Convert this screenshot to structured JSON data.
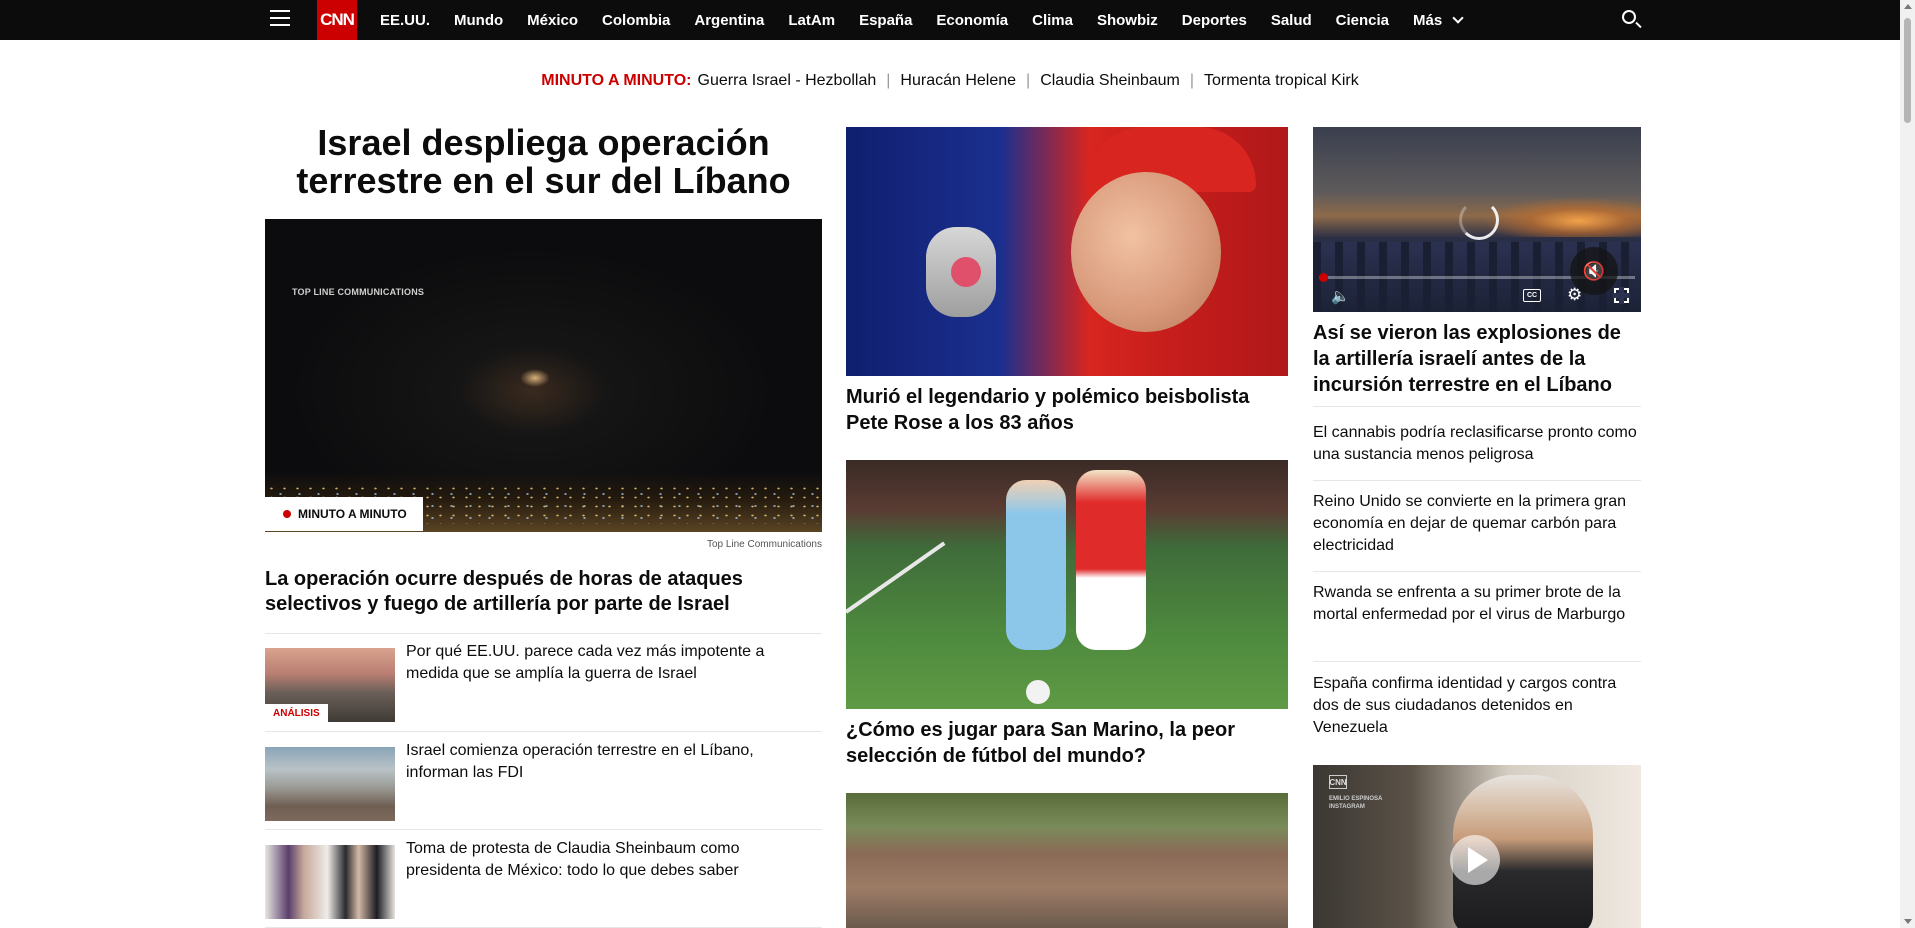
{
  "nav": {
    "logo": "CNN",
    "links": [
      "EE.UU.",
      "Mundo",
      "México",
      "Colombia",
      "Argentina",
      "LatAm",
      "España",
      "Economía",
      "Clima",
      "Showbiz",
      "Deportes",
      "Salud",
      "Ciencia"
    ],
    "more_label": "Más"
  },
  "ticker": {
    "label": "MINUTO A MINUTO:",
    "items": [
      "Guerra Israel - Hezbollah",
      "Huracán Helene",
      "Claudia Sheinbaum",
      "Tormenta tropical Kirk"
    ],
    "separator": "|"
  },
  "lead": {
    "headline": "Israel despliega operación terrestre en el sur del Líbano",
    "image_watermark": "TOP LINE COMMUNICATIONS",
    "live_tag": "MINUTO A MINUTO",
    "image_credit": "Top Line Communications",
    "subheadline": "La operación ocurre después de horas de ataques selectivos y fuego de artillería por parte de Israel",
    "related": [
      {
        "title": "Por qué EE.UU. parece cada vez más impotente a medida que se amplía la guerra de Israel",
        "badge": "ANÁLISIS"
      },
      {
        "title": "Israel comienza operación terrestre en el Líbano, informan las FDI"
      },
      {
        "title": "Toma de protesta de Claudia Sheinbaum como presidenta de México: todo lo que debes saber"
      }
    ]
  },
  "middle": {
    "stories": [
      {
        "title": "Murió el legendario y polémico beisbolista Pete Rose a los 83 años"
      },
      {
        "title": "¿Cómo es jugar para San Marino, la peor selección de fútbol del mundo?"
      }
    ]
  },
  "right": {
    "video_title": "Así se vieron las explosiones de la artillería israelí antes de la incursión terrestre en el Líbano",
    "video_cc": "CC",
    "items": [
      "El cannabis podría reclasificarse pronto como una sustancia menos peligrosa",
      "Reino Unido se convierte en la primera gran economía en dejar de quemar carbón para electricidad",
      "Rwanda se enfrenta a su primer brote de la mortal enfermedad por el virus de Marburgo",
      "España confirma identidad y cargos contra dos de sus ciudadanos detenidos en Venezuela"
    ],
    "video2_logo": "CNN",
    "video2_source": "EMILIO ESPINOSA\nINSTAGRAM"
  },
  "colors": {
    "accent": "#cc0000",
    "nav_bg": "#0c0c0c"
  }
}
